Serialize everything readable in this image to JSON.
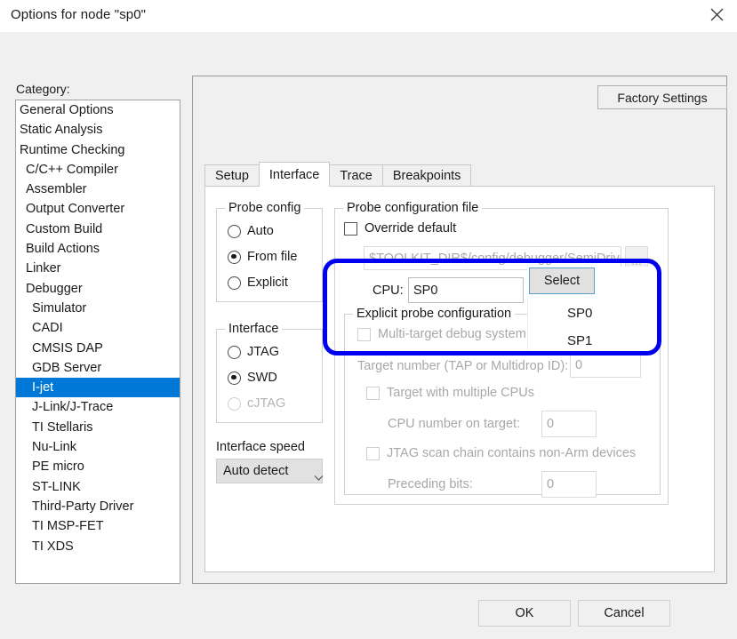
{
  "window": {
    "title": "Options for node \"sp0\"",
    "close_icon": "close-icon"
  },
  "sidebar": {
    "label": "Category:",
    "items": [
      {
        "label": "General Options",
        "indent": 0,
        "selected": false
      },
      {
        "label": "Static Analysis",
        "indent": 0,
        "selected": false
      },
      {
        "label": "Runtime Checking",
        "indent": 0,
        "selected": false
      },
      {
        "label": "C/C++ Compiler",
        "indent": 1,
        "selected": false
      },
      {
        "label": "Assembler",
        "indent": 1,
        "selected": false
      },
      {
        "label": "Output Converter",
        "indent": 1,
        "selected": false
      },
      {
        "label": "Custom Build",
        "indent": 1,
        "selected": false
      },
      {
        "label": "Build Actions",
        "indent": 1,
        "selected": false
      },
      {
        "label": "Linker",
        "indent": 1,
        "selected": false
      },
      {
        "label": "Debugger",
        "indent": 1,
        "selected": false
      },
      {
        "label": "Simulator",
        "indent": 2,
        "selected": false
      },
      {
        "label": "CADI",
        "indent": 2,
        "selected": false
      },
      {
        "label": "CMSIS DAP",
        "indent": 2,
        "selected": false
      },
      {
        "label": "GDB Server",
        "indent": 2,
        "selected": false
      },
      {
        "label": "I-jet",
        "indent": 2,
        "selected": true
      },
      {
        "label": "J-Link/J-Trace",
        "indent": 2,
        "selected": false
      },
      {
        "label": "TI Stellaris",
        "indent": 2,
        "selected": false
      },
      {
        "label": "Nu-Link",
        "indent": 2,
        "selected": false
      },
      {
        "label": "PE micro",
        "indent": 2,
        "selected": false
      },
      {
        "label": "ST-LINK",
        "indent": 2,
        "selected": false
      },
      {
        "label": "Third-Party Driver",
        "indent": 2,
        "selected": false
      },
      {
        "label": "TI MSP-FET",
        "indent": 2,
        "selected": false
      },
      {
        "label": "TI XDS",
        "indent": 2,
        "selected": false
      }
    ]
  },
  "panel": {
    "factory_settings_label": "Factory Settings"
  },
  "tabs": [
    {
      "label": "Setup",
      "active": false
    },
    {
      "label": "Interface",
      "active": true
    },
    {
      "label": "Trace",
      "active": false
    },
    {
      "label": "Breakpoints",
      "active": false
    }
  ],
  "probe_config": {
    "legend": "Probe config",
    "options": [
      {
        "label": "Auto",
        "checked": false,
        "disabled": false
      },
      {
        "label": "From file",
        "checked": true,
        "disabled": false
      },
      {
        "label": "Explicit",
        "checked": false,
        "disabled": false
      }
    ]
  },
  "interface_group": {
    "legend": "Interface",
    "options": [
      {
        "label": "JTAG",
        "checked": false,
        "disabled": false
      },
      {
        "label": "SWD",
        "checked": true,
        "disabled": false
      },
      {
        "label": "cJTAG",
        "checked": false,
        "disabled": true
      }
    ]
  },
  "interface_speed": {
    "label": "Interface speed",
    "value": "Auto detect",
    "caret_icon": "chevron-down-icon"
  },
  "probe_file": {
    "legend": "Probe configuration file",
    "override_label": "Override default",
    "override_checked": false,
    "path_value": "$TOOLKIT_DIR$/config/debugger/SemiDrive/",
    "browse_label": "..."
  },
  "cpu_row": {
    "label": "CPU:",
    "value": "SP0",
    "select_label": "Select"
  },
  "dropdown": {
    "items": [
      "SP0",
      "SP1"
    ]
  },
  "explicit_group": {
    "legend": "Explicit probe configuration",
    "multi_target_label": "Multi-target debug system",
    "multi_target_checked": false,
    "target_number_label": "Target number (TAP or Multidrop ID):",
    "target_number_value": "0",
    "multiple_cpus_label": "Target with multiple CPUs",
    "multiple_cpus_checked": false,
    "cpu_number_label": "CPU number on target:",
    "cpu_number_value": "0",
    "jtag_scan_label": "JTAG scan chain contains non-Arm devices",
    "jtag_scan_checked": false,
    "preceding_bits_label": "Preceding bits:",
    "preceding_bits_value": "0"
  },
  "footer": {
    "ok_label": "OK",
    "cancel_label": "Cancel"
  },
  "colors": {
    "selection": "#0078d7",
    "annotation": "#0000ee",
    "focus_border": "#5a9fd4"
  }
}
